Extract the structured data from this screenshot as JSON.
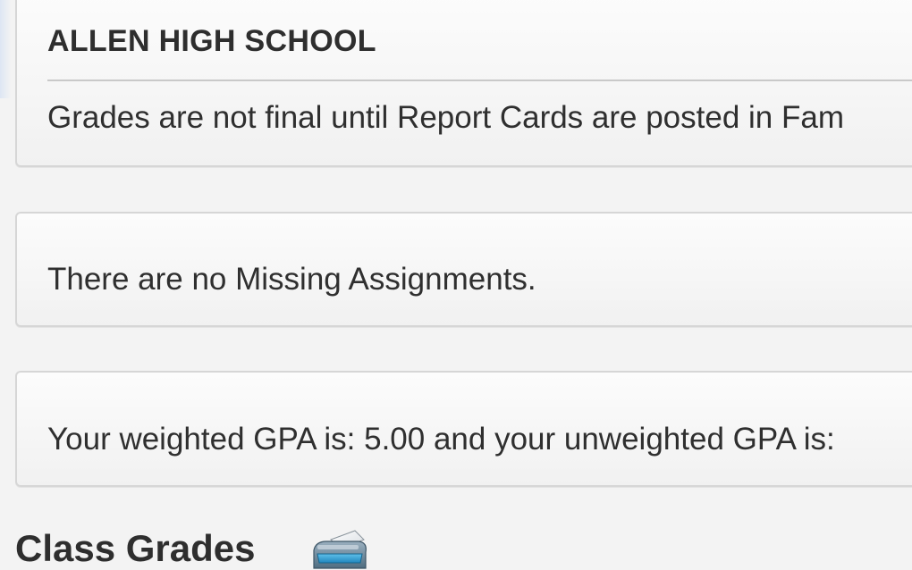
{
  "school_panel": {
    "title": "ALLEN HIGH SCHOOL",
    "notice": "Grades are not final until Report Cards are posted in Fam"
  },
  "missing_panel": {
    "message": "There are no Missing Assignments."
  },
  "gpa_panel": {
    "message": "Your weighted GPA is: 5.00 and your unweighted GPA is:"
  },
  "class_grades": {
    "title": "Class Grades",
    "print_icon": "printer-icon"
  }
}
